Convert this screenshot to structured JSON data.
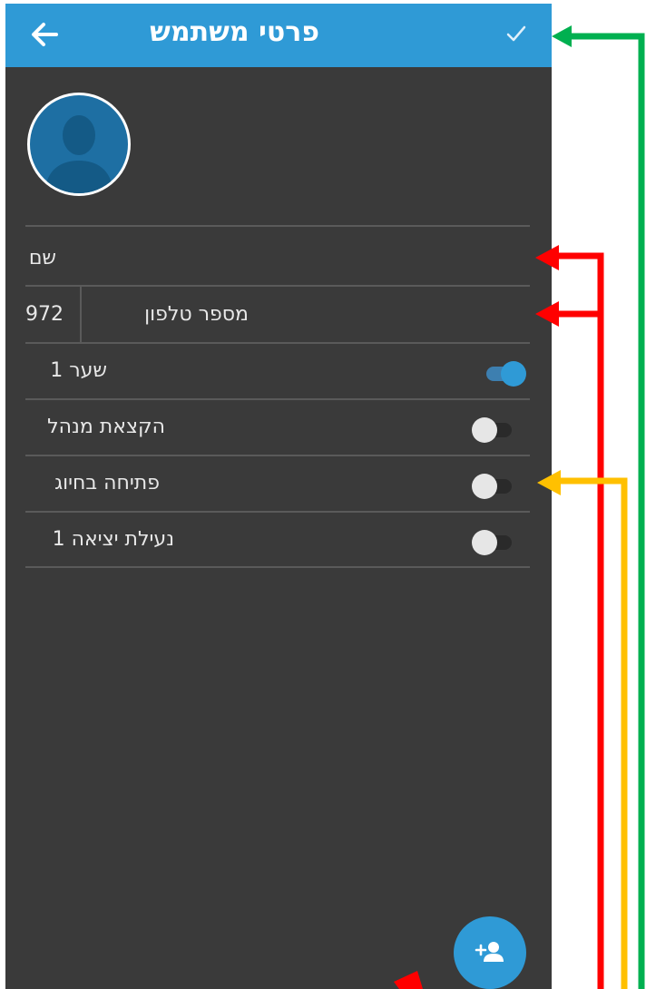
{
  "appbar": {
    "title": "פרטי משתמש",
    "back_icon": "arrow-back-icon",
    "confirm_icon": "check-icon"
  },
  "avatar": {
    "icon": "person-silhouette-icon"
  },
  "form": {
    "name_placeholder": "שם",
    "phone_prefix": "972",
    "phone_placeholder": "מספר טלפון"
  },
  "toggles": [
    {
      "label": "שער 1",
      "on": true
    },
    {
      "label": "הקצאת מנהל",
      "on": false
    },
    {
      "label": "פתיחה בחיוג",
      "on": false
    },
    {
      "label": "נעילת יציאה 1",
      "on": false
    }
  ],
  "fab": {
    "icon": "add-person-icon"
  },
  "colors": {
    "primary": "#2f9ad6",
    "background": "#3a3a3a",
    "annotation_green": "#00b050",
    "annotation_red": "#ff0000",
    "annotation_orange": "#ffc000"
  }
}
